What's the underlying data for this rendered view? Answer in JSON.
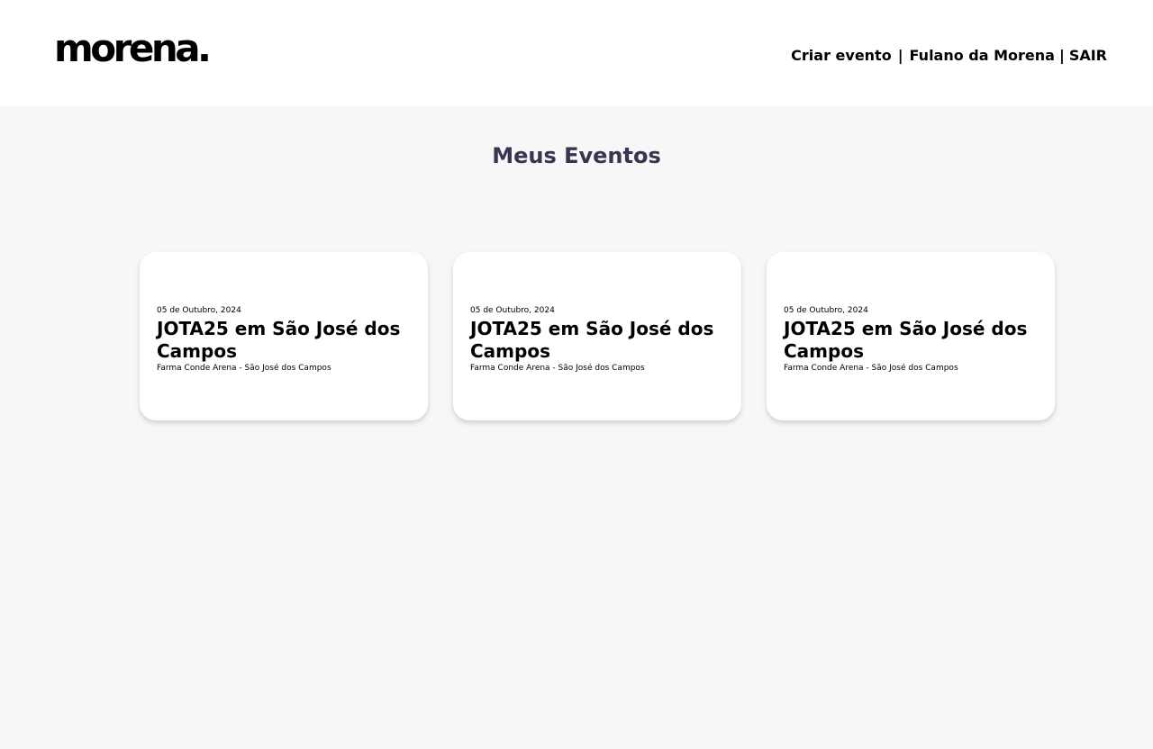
{
  "header": {
    "logo": "morena.",
    "nav": {
      "create_event": "Criar evento",
      "separator": "|",
      "user_name": "Fulano da Morena",
      "separator2": "|",
      "logout": "SAIR"
    }
  },
  "main": {
    "title": "Meus Eventos",
    "events": [
      {
        "date": "05 de Outubro, 2024",
        "title": "JOTA25 em São José dos Campos",
        "venue": "Farma Conde Arena - São José dos Campos"
      },
      {
        "date": "05 de Outubro, 2024",
        "title": "JOTA25 em São José dos Campos",
        "venue": "Farma Conde Arena - São José dos Campos"
      },
      {
        "date": "05 de Outubro, 2024",
        "title": "JOTA25 em São José dos Campos",
        "venue": "Farma Conde Arena - São José dos Campos"
      }
    ]
  }
}
